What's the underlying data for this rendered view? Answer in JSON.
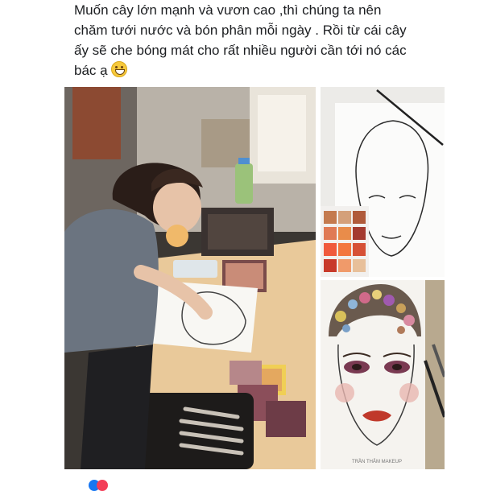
{
  "post": {
    "line1": "Muốn cây lớn mạnh và vươn cao ,thì chúng ta nên",
    "line2": "chăm tưới nước và bón phân mỗi ngày . Rồi từ cái cây",
    "line3": "ấy sẽ che bóng mát cho rất nhiều người cần tới nó các",
    "line4": "bác ạ",
    "emoji": "grinning-face-emoji"
  },
  "photos": {
    "main": "photo-girl-drawing-makeup-face-chart",
    "top_right": "photo-blank-face-chart-with-palette",
    "bottom_right": "photo-finished-face-chart",
    "watermark": "TRẦN THẮM MAKEUP"
  },
  "colors": {
    "text": "#1c1e21",
    "lip": "#c0392b",
    "eyeshadow": "#7a3a52"
  }
}
